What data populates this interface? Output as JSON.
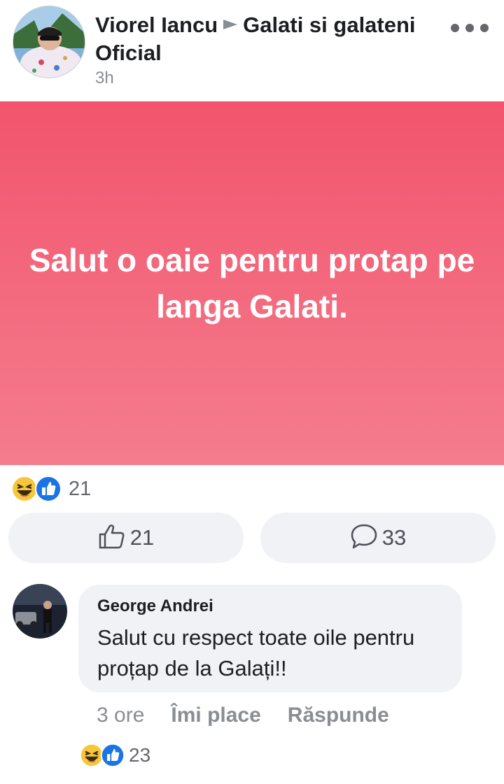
{
  "post": {
    "author": "Viorel Iancu",
    "group": "Galati si galateni Oficial",
    "time": "3h",
    "text": "Salut o oaie pentru protap pe langa Galati.",
    "reaction_count": "21",
    "like_count": "21",
    "comment_count": "33",
    "background_colors": [
      "#f2546d",
      "#f47d8d"
    ]
  },
  "comment": {
    "author": "George Andrei",
    "text": "Salut cu respect toate oile pentru proțap de la Galați!!",
    "time": "3 ore",
    "like_label": "Îmi place",
    "reply_label": "Răspunde",
    "reaction_count": "23"
  },
  "icons": {
    "more": "more-options-icon",
    "haha": "haha-reaction-icon",
    "like": "like-reaction-icon",
    "like_button": "thumbs-up-icon",
    "comment_button": "comment-bubble-icon",
    "arrow": "triangle-right-icon"
  }
}
